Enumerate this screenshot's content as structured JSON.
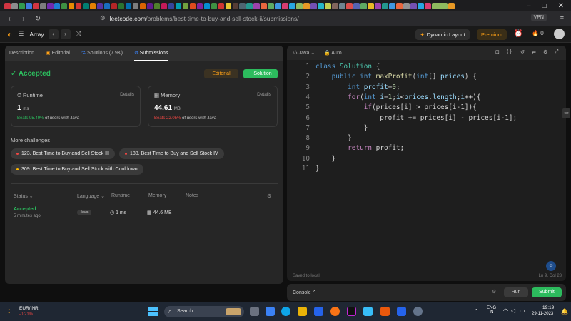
{
  "browser": {
    "url_host": "leetcode.com",
    "url_path": "/problems/best-time-to-buy-and-sell-stock-ii/submissions/",
    "vpn_label": "VPN",
    "tab_colors": [
      "#e63946",
      "#999",
      "#34a853",
      "#4285f4",
      "#e63946",
      "#888",
      "#7b2cbf",
      "#1e88e5",
      "#43a047",
      "#ff9800",
      "#e53935",
      "#00897b",
      "#fb8c00",
      "#5e35b1",
      "#1976d2",
      "#c62828",
      "#2e7d32",
      "#0277bd",
      "#888",
      "#ef6c00",
      "#6a1b9a",
      "#558b2f",
      "#d81b60",
      "#3949ab",
      "#00acc1",
      "#7cb342",
      "#f4511e",
      "#8e24aa",
      "#039be5",
      "#43a047",
      "#e53935",
      "#fdd835",
      "#5d4037",
      "#546e7a",
      "#26a69a",
      "#ab47bc",
      "#ff7043",
      "#66bb6a",
      "#42a5f5",
      "#ec407a",
      "#29b6f6",
      "#9ccc65",
      "#ffa726",
      "#7e57c2",
      "#26c6da",
      "#d4e157",
      "#8d6e63",
      "#78909c",
      "#ef5350",
      "#5c6bc0",
      "#66bb6a",
      "#ffca28",
      "#ab47bc",
      "#26a69a",
      "#42a5f5",
      "#ff7043",
      "#9e9e9e",
      "#7e57c2",
      "#29b6f6",
      "#ec407a",
      "#9ccc65",
      "#ffa726"
    ]
  },
  "header": {
    "problem_list": "Array",
    "dynamic_layout": "Dynamic Layout",
    "premium": "Premium",
    "streak": "0"
  },
  "left_tabs": [
    "Description",
    "Editorial",
    "Solutions (7.9K)",
    "Submissions"
  ],
  "result": {
    "status": "Accepted",
    "editorial_btn": "Editorial",
    "solution_btn": "Solution",
    "runtime_label": "Runtime",
    "runtime_details": "Details",
    "runtime_value": "1",
    "runtime_unit": "ms",
    "runtime_beats_pct": "Beats 95.49%",
    "runtime_beats_text": "of users with Java",
    "memory_label": "Memory",
    "memory_details": "Details",
    "memory_value": "44.61",
    "memory_unit": "MB",
    "memory_beats_pct": "Beats 22.05%",
    "memory_beats_text": "of users with Java"
  },
  "more_challenges": {
    "title": "More challenges",
    "items": [
      {
        "label": "123. Best Time to Buy and Sell Stock III",
        "color": "#ef4743"
      },
      {
        "label": "188. Best Time to Buy and Sell Stock IV",
        "color": "#ef4743"
      },
      {
        "label": "309. Best Time to Buy and Sell Stock with Cooldown",
        "color": "#ffb800"
      }
    ]
  },
  "table": {
    "headers": [
      "Status",
      "Language",
      "Runtime",
      "Memory",
      "Notes"
    ],
    "row": {
      "status": "Accepted",
      "time": "5 minutes ago",
      "language": "Java",
      "runtime": "1 ms",
      "memory": "44.6 MB"
    }
  },
  "editor": {
    "language": "Java",
    "mode": "Auto",
    "saved": "Saved to local",
    "cursor": "Ln 9, Col 23",
    "line_numbers": [
      "1",
      "2",
      "3",
      "4",
      "5",
      "6",
      "7",
      "8",
      "9",
      "10",
      "11"
    ]
  },
  "console": {
    "label": "Console",
    "run": "Run",
    "submit": "Submit"
  },
  "taskbar": {
    "stock_name": "EUR/INR",
    "stock_change": "-0.21%",
    "search": "Search",
    "lang_top": "ENG",
    "lang_bottom": "IN",
    "time": "19:19",
    "date": "29-11-2023"
  }
}
